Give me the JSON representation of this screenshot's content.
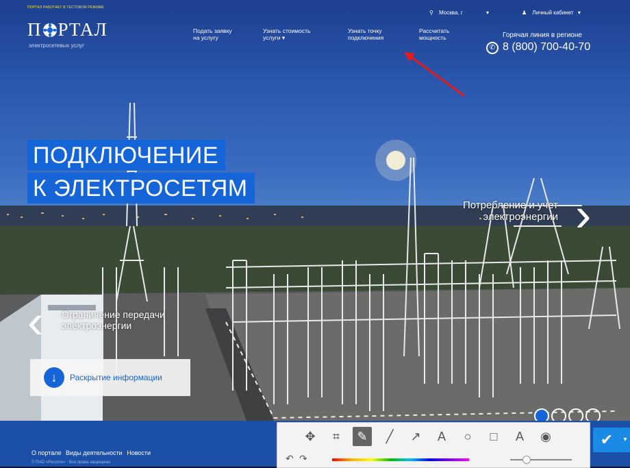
{
  "header": {
    "tagline": "ПОРТАЛ РАБОТАЕТ В ТЕСТОВОМ РЕЖИМЕ",
    "logo_left": "П",
    "logo_right": "РТАЛ",
    "logo_sub": "электросетевых услуг",
    "nav": [
      {
        "line1": "Подать заявку",
        "line2": "на услугу"
      },
      {
        "line1": "Узнать стоимость",
        "line2": "услуги ▾"
      },
      {
        "line1": "Узнать точку",
        "line2": "подключения"
      },
      {
        "line1": "Рассчитать",
        "line2": "мощность"
      }
    ],
    "location": "Москва, г",
    "location_caret": "▾",
    "account": "Личный кабинет",
    "account_caret": "▾",
    "hotline_label": "Горячая линия в регионе",
    "hotline_phone": "8 (800) 700-40-70"
  },
  "hero": {
    "title_line1": "ПОДКЛЮЧЕНИЕ",
    "title_line2": "К ЭЛЕКТРОСЕТЯМ",
    "next_slide_line1": "Потребление и учет",
    "next_slide_line2": "электроэнергии",
    "prev_slide_line1": "Ограничение передачи",
    "prev_slide_line2": "электроэнергии",
    "disclosure_label": "Раскрытие информации",
    "slide_count": 4,
    "active_slide": 1
  },
  "footer": {
    "links": [
      "О портале",
      "Виды деятельности",
      "Новости"
    ],
    "subtext": "© ПАО «Россети» · Все права защищены"
  },
  "toolbar": {
    "tools": [
      "move",
      "crop",
      "pencil",
      "line",
      "arrow",
      "text",
      "ellipse",
      "rectangle",
      "text-outline",
      "blur"
    ],
    "active_tool": "pencil",
    "confirm": "✔",
    "confirm_caret": "▾"
  },
  "colors": {
    "accent": "#1565d8",
    "annotation_arrow": "#e21b1b"
  }
}
